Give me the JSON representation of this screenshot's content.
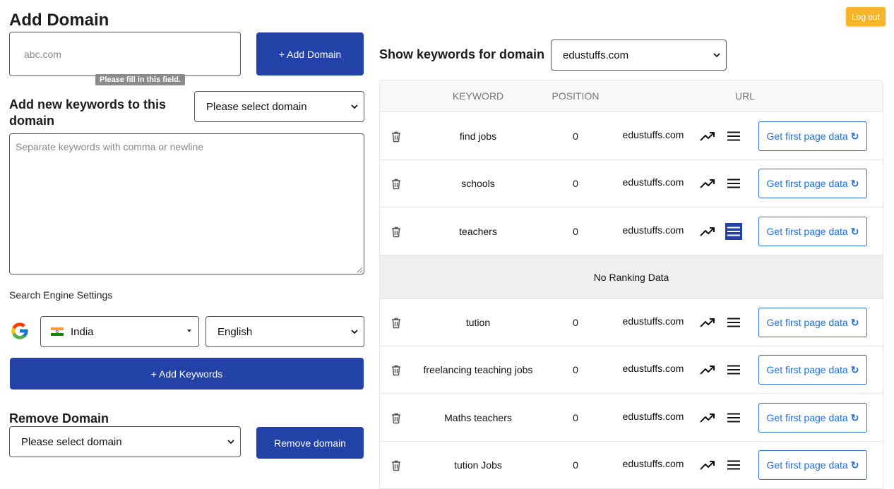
{
  "add_domain": {
    "title": "Add Domain",
    "input_placeholder": "abc.com",
    "tooltip": "Please fill in this field.",
    "button": "+ Add Domain"
  },
  "add_keywords": {
    "title": "Add new keywords to this domain",
    "domain_select": "Please select domain",
    "textarea_placeholder": "Separate keywords with comma or newline",
    "engine_settings_label": "Search Engine Settings",
    "country": "India",
    "language": "English",
    "button": "+ Add Keywords"
  },
  "remove_domain": {
    "title": "Remove Domain",
    "domain_select": "Please select domain",
    "button": "Remove domain"
  },
  "header": {
    "logout": "Log out",
    "show_keywords_label": "Show keywords for domain",
    "domain_select": "edustuffs.com"
  },
  "table": {
    "columns": [
      "KEYWORD",
      "POSITION",
      "URL"
    ],
    "rows": [
      {
        "keyword": "find jobs",
        "position": "0",
        "url": "edustuffs.com",
        "action": "Get first page data"
      },
      {
        "keyword": "schools",
        "position": "0",
        "url": "edustuffs.com",
        "action": "Get first page data"
      },
      {
        "keyword": "teachers",
        "position": "0",
        "url": "edustuffs.com",
        "action": "Get first page data"
      },
      {
        "keyword": "tution",
        "position": "0",
        "url": "edustuffs.com",
        "action": "Get first page data"
      },
      {
        "keyword": "freelancing teaching jobs",
        "position": "0",
        "url": "edustuffs.com",
        "action": "Get first page data"
      },
      {
        "keyword": "Maths teachers",
        "position": "0",
        "url": "edustuffs.com",
        "action": "Get first page data"
      },
      {
        "keyword": "tution Jobs",
        "position": "0",
        "url": "edustuffs.com",
        "action": "Get first page data"
      }
    ],
    "no_ranking": "No Ranking Data",
    "refresh_glyph": "↻"
  },
  "colors": {
    "primary": "#2342a8",
    "logout": "#f7b52c",
    "link": "#1f6fe0"
  }
}
